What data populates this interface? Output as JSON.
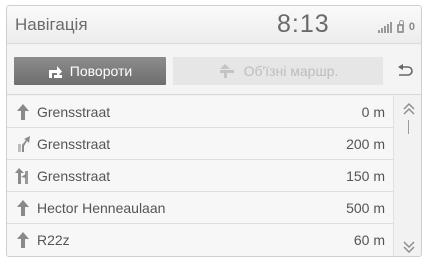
{
  "header": {
    "title": "Навігація",
    "clock": "8:13",
    "status_badge": "0"
  },
  "tabs": {
    "turns_label": "Повороти",
    "detour_label": "Об'їзні маршр."
  },
  "directions": [
    {
      "street": "Grensstraat",
      "distance": "0 m",
      "icon": "straight-arrow-icon"
    },
    {
      "street": "Grensstraat",
      "distance": "200 m",
      "icon": "slight-right-arrow-icon"
    },
    {
      "street": "Grensstraat",
      "distance": "150 m",
      "icon": "keep-left-arrow-icon"
    },
    {
      "street": "Hector Henneaulaan",
      "distance": "500 m",
      "icon": "straight-arrow-icon"
    },
    {
      "street": "R22z",
      "distance": "60 m",
      "icon": "straight-arrow-icon"
    }
  ],
  "colors": {
    "active_tab": "#7d7d7d",
    "inactive_tab": "#e6e6e6",
    "text": "#555555"
  }
}
